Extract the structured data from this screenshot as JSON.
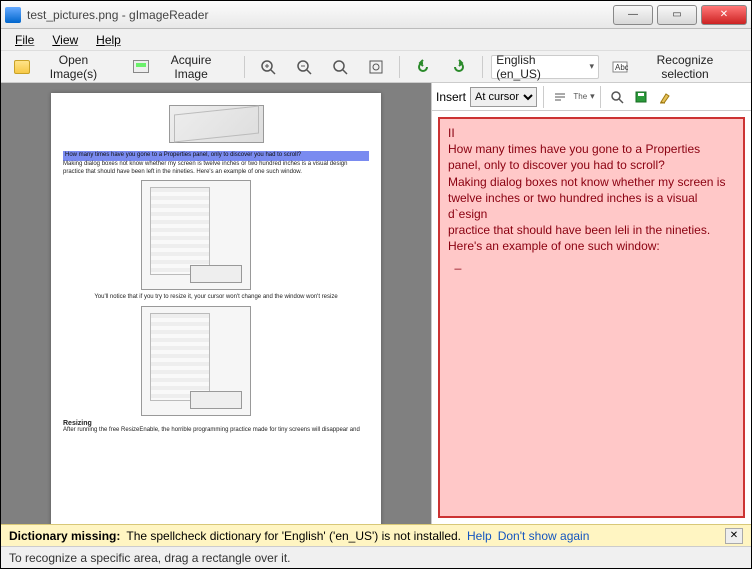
{
  "title": "test_pictures.png - gImageReader",
  "menubar": {
    "file": "File",
    "view": "View",
    "help": "Help"
  },
  "toolbar": {
    "open_images": "Open Image(s)",
    "acquire_image": "Acquire Image",
    "language": "English (en_US)",
    "recognize": "Recognize selection"
  },
  "ocr_bar": {
    "insert_label": "Insert",
    "insert_mode": "At cursor",
    "the_label": "The"
  },
  "ocr_text": "II\nHow many times have you gone to a Properties panel, only to discover you had to scroll?\nMaking dialog boxes not know whether my screen is twelve inches or two hundred inches is a visual d`esign\npractice that should have been leli in the nineties. Here's an example of one such window:\n  _",
  "page_preview": {
    "highlight_line": "How many times have you gone to a Properties panel, only to discover you had to scroll?",
    "para1": "Making dialog boxes not know whether my screen is twelve inches or two hundred inches is a visual design practice that should have been left in the nineties. Here's an example of one such window.",
    "caption1": "You'll notice that if you try to resize it, your cursor won't change and the window won't resize",
    "heading": "Resizing",
    "para2": "After running the free ResizeEnable, the horrible programming practice made for tiny screens will disappear and"
  },
  "notice": {
    "bold": "Dictionary missing:",
    "text": "The spellcheck dictionary for 'English' ('en_US') is not installed.",
    "help": "Help",
    "dont_show": "Don't show again"
  },
  "status": "To recognize a specific area, drag a rectangle over it."
}
